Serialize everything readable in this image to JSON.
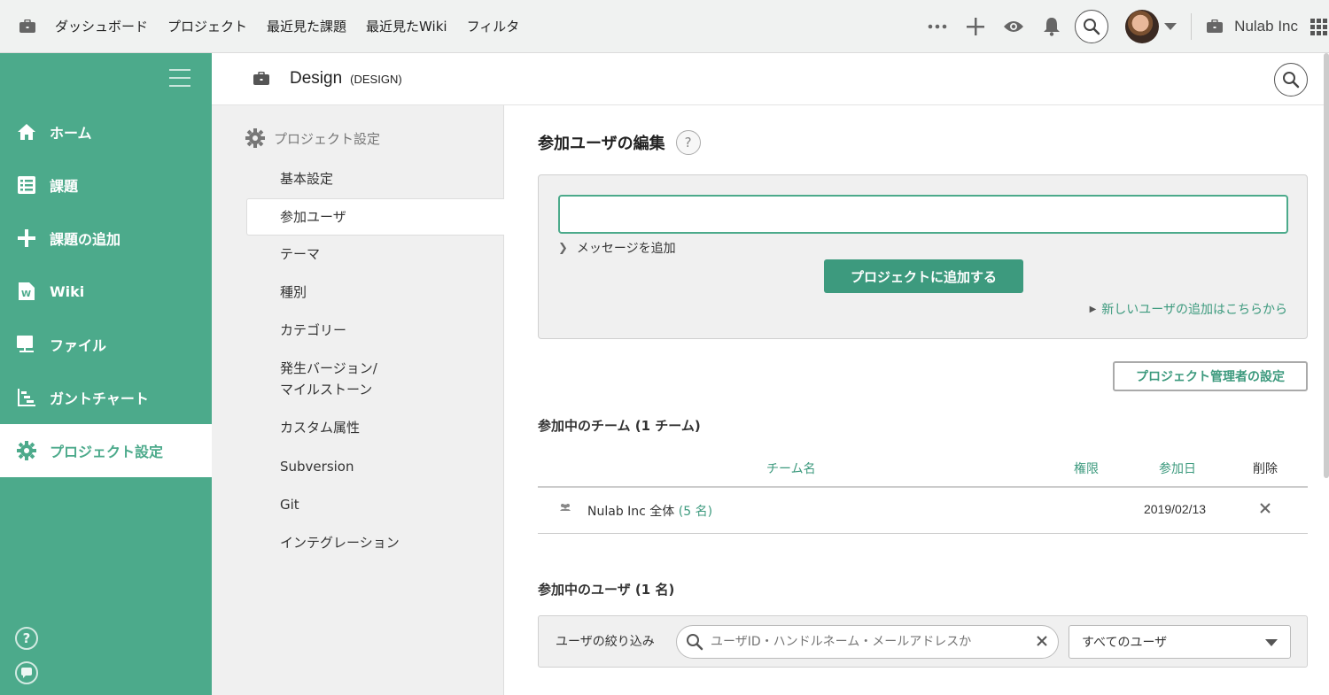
{
  "topbar": {
    "nav": [
      "ダッシュボード",
      "プロジェクト",
      "最近見た課題",
      "最近見たWiki",
      "フィルタ"
    ],
    "org_name": "Nulab Inc"
  },
  "sidebar": {
    "items": [
      {
        "label": "ホーム",
        "icon": "home-icon"
      },
      {
        "label": "課題",
        "icon": "list-icon"
      },
      {
        "label": "課題の追加",
        "icon": "plus-icon"
      },
      {
        "label": "Wiki",
        "icon": "wiki-icon"
      },
      {
        "label": "ファイル",
        "icon": "folder-icon"
      },
      {
        "label": "ガントチャート",
        "icon": "gantt-icon"
      },
      {
        "label": "プロジェクト設定",
        "icon": "gear-icon"
      }
    ],
    "active_index": 6,
    "bottom": {
      "help": "?"
    }
  },
  "project": {
    "name": "Design",
    "key": "(DESIGN)"
  },
  "settings_menu": {
    "title": "プロジェクト設定",
    "items": [
      "基本設定",
      "参加ユーザ",
      "テーマ",
      "種別",
      "カテゴリー",
      "発生バージョン/",
      "マイルストーン",
      "カスタム属性",
      "Subversion",
      "Git",
      "インテグレーション"
    ],
    "active": "参加ユーザ"
  },
  "main": {
    "title": "参加ユーザの編集",
    "help": "?",
    "add_user_input_value": "",
    "message_toggle": "メッセージを追加",
    "add_button": "プロジェクトに追加する",
    "new_user_link": "新しいユーザの追加はこちらから",
    "admin_button": "プロジェクト管理者の設定",
    "teams_section_title": "参加中のチーム (1 チーム)",
    "team_table": {
      "headers": [
        "チーム名",
        "権限",
        "参加日",
        "削除"
      ],
      "rows": [
        {
          "name": "Nulab Inc 全体",
          "count": "(5 名)",
          "date": "2019/02/13"
        }
      ]
    },
    "users_section_title": "参加中のユーザ (1 名)",
    "filter": {
      "label": "ユーザの絞り込み",
      "placeholder": "ユーザID・ハンドルネーム・メールアドレスか",
      "select_value": "すべてのユーザ"
    }
  },
  "colors": {
    "accent": "#4caa8b",
    "accent_dark": "#3d9a7e"
  }
}
